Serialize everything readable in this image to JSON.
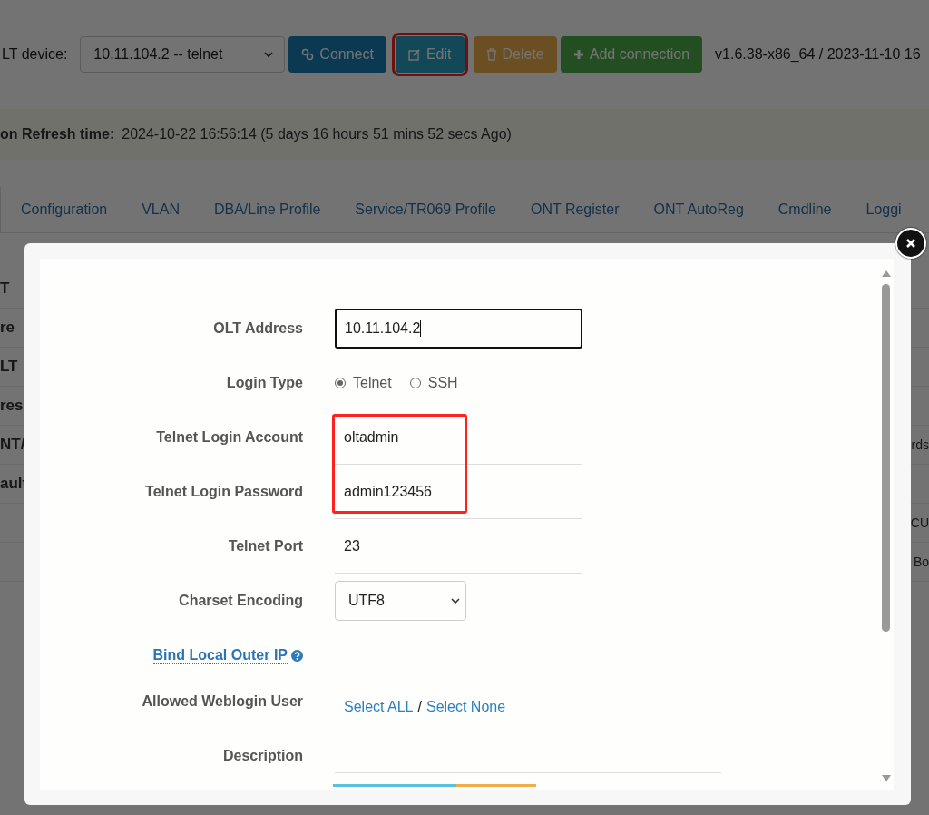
{
  "toolbar": {
    "device_label": "LT device:",
    "device_select": "10.11.104.2 -- telnet",
    "version": "v1.6.38-x86_64 / 2023-11-10 16",
    "buttons": [
      {
        "label": "Connect",
        "kind": "connect",
        "highlighted": false
      },
      {
        "label": "Edit",
        "kind": "edit",
        "highlighted": true
      },
      {
        "label": "Delete",
        "kind": "delete",
        "highlighted": false
      },
      {
        "label": "Add connection",
        "kind": "add",
        "highlighted": false
      }
    ]
  },
  "refresh": {
    "label": "on Refresh time:",
    "value": "2024-10-22 16:56:14 (5 days 16 hours 51 mins 52 secs Ago)"
  },
  "tabs": [
    {
      "label": "Configuration",
      "selected": false
    },
    {
      "label": "VLAN",
      "selected": false
    },
    {
      "label": "DBA/Line Profile",
      "selected": false
    },
    {
      "label": "Service/TR069 Profile",
      "selected": false
    },
    {
      "label": "ONT Register",
      "selected": false
    },
    {
      "label": "ONT AutoReg",
      "selected": false
    },
    {
      "label": "Cmdline",
      "selected": false
    },
    {
      "label": "Loggi",
      "selected": false
    }
  ],
  "background_rows": [
    {
      "left": "T",
      "right": ""
    },
    {
      "left": "re",
      "right": ""
    },
    {
      "left": "LT",
      "right": ""
    },
    {
      "left": "res",
      "right": ""
    },
    {
      "left": "NT/",
      "right": "rds"
    },
    {
      "left": "ault",
      "right": ""
    },
    {
      "left": "",
      "right": "CU"
    },
    {
      "left": "",
      "right": "Bo"
    }
  ],
  "modal": {
    "olt_address": {
      "label": "OLT Address",
      "value": "10.11.104.2"
    },
    "login_type": {
      "label": "Login Type",
      "options": [
        {
          "label": "Telnet",
          "selected": true
        },
        {
          "label": "SSH",
          "selected": false
        }
      ]
    },
    "credentials": {
      "highlighted": true,
      "fields": [
        {
          "label": "Telnet Login Account",
          "value": "oltadmin"
        },
        {
          "label": "Telnet Login Password",
          "value": "admin123456"
        }
      ]
    },
    "port": {
      "label": "Telnet Port",
      "value": "23"
    },
    "charset": {
      "label": "Charset Encoding",
      "value": "UTF8"
    },
    "bind_ip": {
      "label": "Bind Local Outer IP"
    },
    "weblogin": {
      "label": "Allowed Weblogin User",
      "select_all": "Select ALL",
      "separator": "/",
      "select_none": "Select None"
    },
    "description": {
      "label": "Description"
    }
  }
}
